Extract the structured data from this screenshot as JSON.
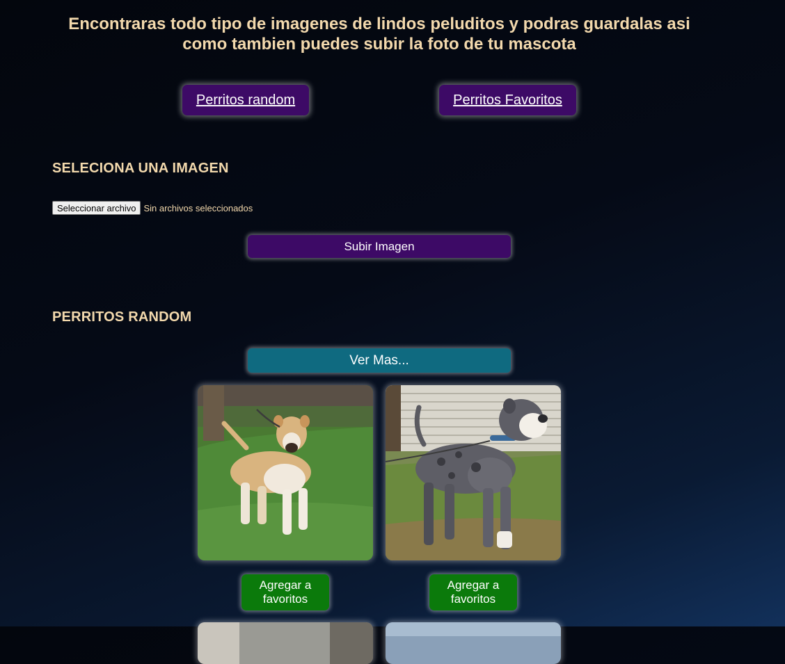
{
  "header": {
    "text": "Encontraras todo tipo de imagenes de lindos peluditos y podras guardalas asi como tambien puedes subir la foto de tu mascota"
  },
  "nav": {
    "random_label": "Perritos random",
    "favorites_label": "Perritos Favoritos"
  },
  "upload": {
    "title": "SELECIONA UNA IMAGEN",
    "file_button_label": "Seleccionar archivo",
    "file_status": "Sin archivos seleccionados",
    "submit_label": "Subir Imagen"
  },
  "random": {
    "title": "PERRITOS RANDOM",
    "more_label": "Ver Mas...",
    "cards": [
      {
        "fav_label": "Agregar a favoritos"
      },
      {
        "fav_label": "Agregar a favoritos"
      }
    ]
  },
  "colors": {
    "accent_purple": "#3d0a66",
    "accent_teal": "#0f6a80",
    "accent_green": "#0b7a0b",
    "text_cream": "#f3d9ad"
  }
}
